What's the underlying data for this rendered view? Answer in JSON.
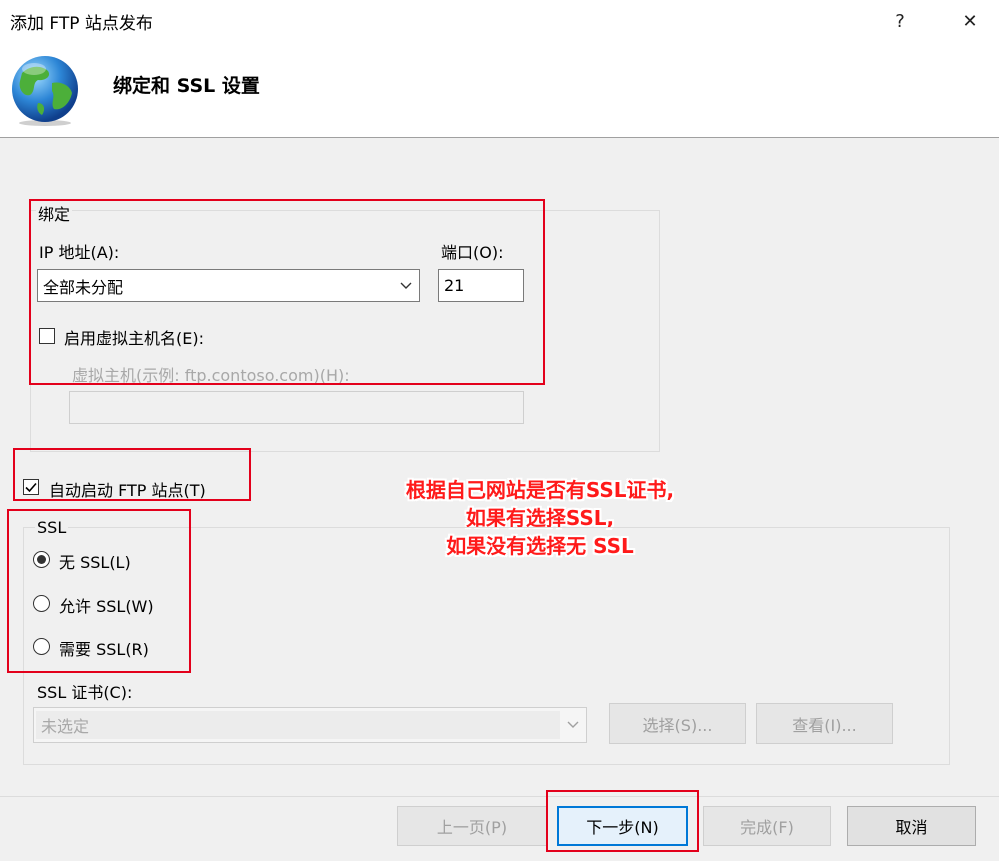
{
  "window": {
    "title": "添加 FTP 站点发布",
    "help_label": "?",
    "close_label": "✕"
  },
  "header": {
    "title": "绑定和 SSL 设置",
    "icon": "globe-icon"
  },
  "binding": {
    "group_label": "绑定",
    "ip_label": "IP 地址(A):",
    "ip_value": "全部未分配",
    "port_label": "端口(O):",
    "port_value": "21",
    "virtual_host_checkbox_label": "启用虚拟主机名(E):",
    "virtual_host_checked": false,
    "virtual_host_label": "虚拟主机(示例: ftp.contoso.com)(H):",
    "virtual_host_value": ""
  },
  "autostart": {
    "label": "自动启动 FTP 站点(T)",
    "checked": true
  },
  "ssl": {
    "group_label": "SSL",
    "options": [
      {
        "label": "无 SSL(L)",
        "selected": true
      },
      {
        "label": "允许 SSL(W)",
        "selected": false
      },
      {
        "label": "需要 SSL(R)",
        "selected": false
      }
    ],
    "cert_label": "SSL 证书(C):",
    "cert_value": "未选定",
    "select_button": "选择(S)...",
    "view_button": "查看(I)..."
  },
  "annotation": {
    "line1": "根据自己网站是否有SSL证书,",
    "line2": "如果有选择SSL,",
    "line3": "如果没有选择无 SSL"
  },
  "footer": {
    "prev_button": "上一页(P)",
    "next_button": "下一步(N)",
    "finish_button": "完成(F)",
    "cancel_button": "取消"
  },
  "colors": {
    "accent": "#0078d7",
    "annotation": "#e3001b",
    "background": "#f0f0f0"
  }
}
